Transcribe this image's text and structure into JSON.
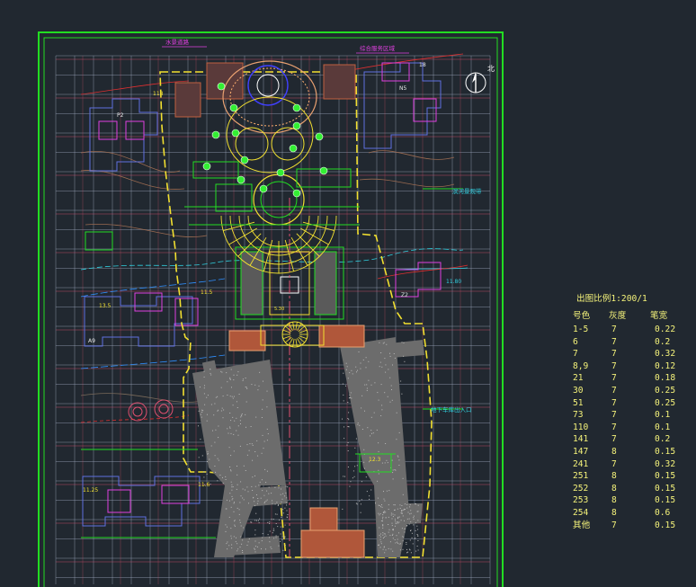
{
  "drawing": {
    "north_label": "北",
    "label_north_road": "水景道路",
    "label_north_right": "综合服务区域",
    "label_lot_top_right": "18",
    "label_road_right": "滨河景观带",
    "label_lot_118": "118",
    "label_lot_11_5": "11.5",
    "label_lot_11_80": "11.80",
    "label_lot_13_5": "13.5",
    "label_lot_11_25": "11.25",
    "label_lot_11_6": "11.6",
    "label_lot_12_3": "12.3",
    "label_lot_a9": "A9",
    "label_lot_n5": "N5",
    "label_lot_z2": "Z2",
    "label_lot_p2": "P2",
    "label_parking": "地下车库出入口",
    "label_mid_small": "5.30"
  },
  "legend": {
    "title": "出图比例1:200/1",
    "headers": [
      "号色",
      "灰度",
      "笔宽"
    ],
    "rows": [
      [
        "1-5",
        "7",
        "0.22"
      ],
      [
        "6",
        "7",
        "0.2"
      ],
      [
        "7",
        "7",
        "0.32"
      ],
      [
        "8,9",
        "7",
        "0.12"
      ],
      [
        "21",
        "7",
        "0.18"
      ],
      [
        "30",
        "7",
        "0.25"
      ],
      [
        "51",
        "7",
        "0.25"
      ],
      [
        "73",
        "7",
        "0.1"
      ],
      [
        "110",
        "7",
        "0.1"
      ],
      [
        "141",
        "7",
        "0.2"
      ],
      [
        "147",
        "8",
        "0.15"
      ],
      [
        "241",
        "7",
        "0.32"
      ],
      [
        "251",
        "8",
        "0.15"
      ],
      [
        "252",
        "8",
        "0.15"
      ],
      [
        "253",
        "8",
        "0.15"
      ],
      [
        "254",
        "8",
        "0.6"
      ],
      [
        "其他",
        "7",
        "0.15"
      ]
    ]
  },
  "colors": {
    "background": "#212830",
    "frame": "#22dd22",
    "grid": "#a8b0c8",
    "gridline_red": "#e05070",
    "boundary": "#f2e030",
    "magenta": "#e040e0",
    "cyan": "#30d0e0",
    "building_blue": "#6070e0",
    "paving": "#e8a070",
    "path_grey": "#6c6c6c",
    "legend_text": "#f4f27a"
  }
}
